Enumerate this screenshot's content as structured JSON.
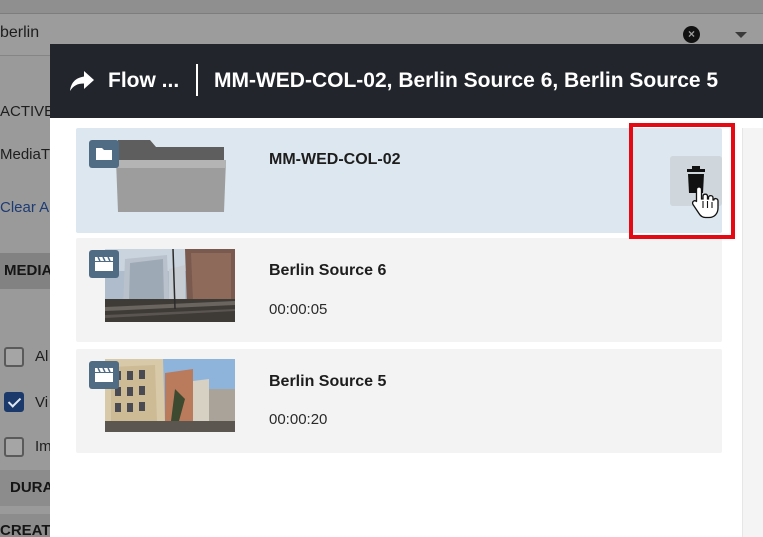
{
  "background": {
    "search_value": "berlin",
    "left_labels": {
      "active": "ACTIVE",
      "media_type": "MediaT",
      "clear_all": "Clear Al",
      "media": "MEDIA",
      "opt_all": "Al",
      "opt_video": "Vi",
      "opt_image": "Im",
      "duration": "DURA",
      "created": "CREAT"
    }
  },
  "modal": {
    "breadcrumb_short": "Flow ...",
    "title": "MM-WED-COL-02, Berlin Source 6, Berlin Source 5",
    "items": [
      {
        "type": "folder",
        "type_icon": "folder-icon",
        "title": "MM-WED-COL-02",
        "duration": ""
      },
      {
        "type": "video",
        "type_icon": "clapperboard-icon",
        "title": "Berlin Source 6",
        "duration": "00:00:05"
      },
      {
        "type": "video",
        "type_icon": "clapperboard-icon",
        "title": "Berlin Source 5",
        "duration": "00:00:20"
      }
    ]
  },
  "colors": {
    "header_bg": "#22262c",
    "selected_row": "#dde7ef",
    "badge": "#506c85",
    "highlight": "#e50914"
  }
}
